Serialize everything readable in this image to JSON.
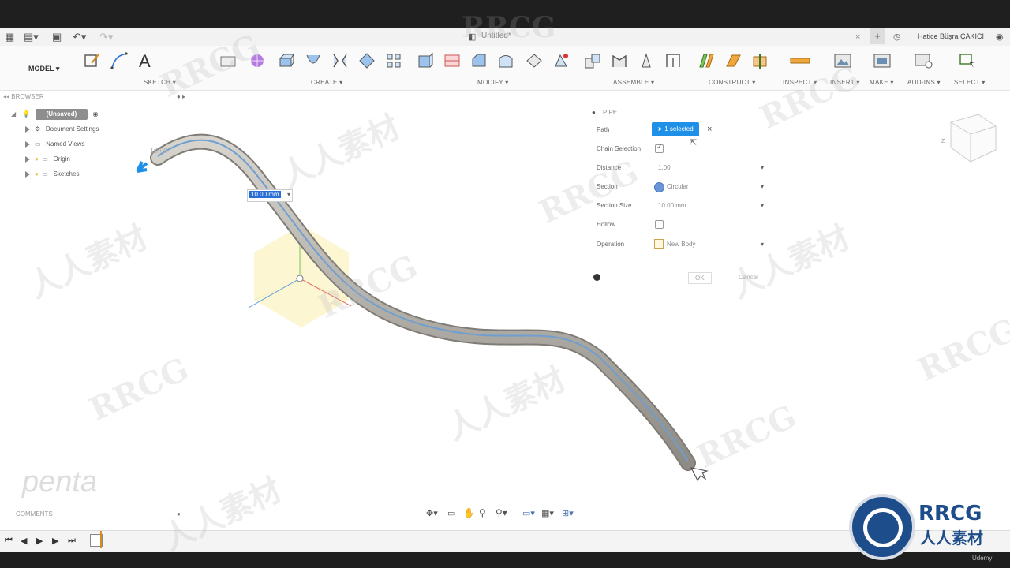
{
  "app": {
    "doc_title": "Untitled*",
    "user_name": "Hatice Büşra ÇAKICI"
  },
  "toolbar": {
    "workspace": "MODEL",
    "groups": [
      "SKETCH",
      "CREATE",
      "MODIFY",
      "ASSEMBLE",
      "CONSTRUCT",
      "INSPECT",
      "INSERT",
      "MAKE",
      "ADD-INS",
      "SELECT"
    ]
  },
  "browser": {
    "title": "BROWSER",
    "root": "(Unsaved)",
    "items": [
      "Document Settings",
      "Named Views",
      "Origin",
      "Sketches"
    ]
  },
  "pipe_panel": {
    "title": "PIPE",
    "path_label": "Path",
    "path_value": "1 selected",
    "chain_label": "Chain Selection",
    "distance_label": "Distance",
    "distance_value": "1.00",
    "section_label": "Section",
    "section_value": "Circular",
    "section_size_label": "Section Size",
    "section_size_value": "10.00 mm",
    "hollow_label": "Hollow",
    "operation_label": "Operation",
    "operation_value": "New Body",
    "ok": "OK",
    "cancel": "Cancel"
  },
  "canvas": {
    "dimension_input": "10.00 mm",
    "sweep_start_label": "10.00"
  },
  "comments": {
    "label": "COMMENTS"
  },
  "watermarks": {
    "left_logo": "penta",
    "brand": "RRCG",
    "brand_cn": "人人素材",
    "udemy": "Udemy"
  },
  "colors": {
    "accent": "#1e90e8",
    "dark_bar": "#1f1f1f"
  }
}
